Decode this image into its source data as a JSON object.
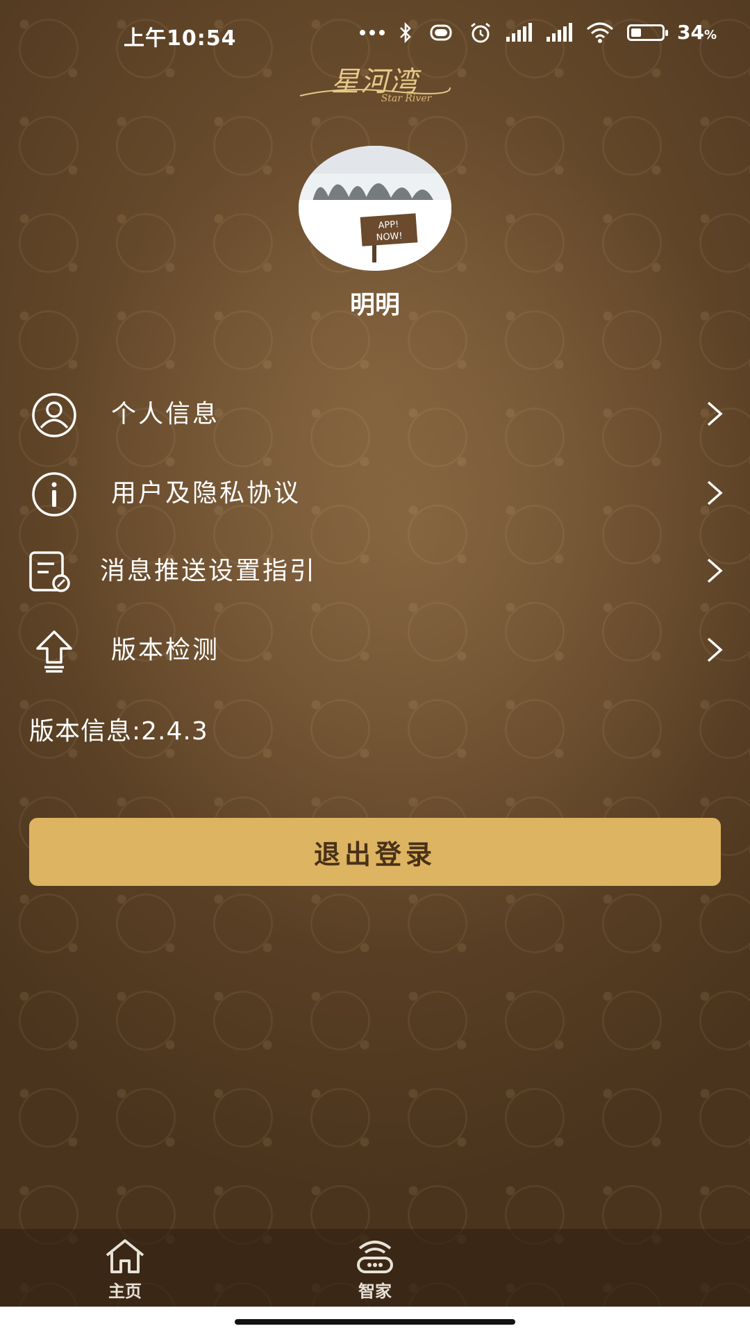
{
  "status_bar": {
    "time": "上午10:54",
    "battery_text": "34",
    "battery_unit": "%",
    "battery_level": 0.34,
    "icons": [
      "more-dots-icon",
      "bluetooth-icon",
      "vibrate-icon",
      "alarm-icon",
      "signal-icon",
      "signal-icon",
      "wifi-icon",
      "battery-icon"
    ]
  },
  "logo": {
    "text": "星河湾",
    "sub": "Star River"
  },
  "profile": {
    "username": "明明"
  },
  "menu": [
    {
      "label": "个人信息",
      "icon": "user-icon"
    },
    {
      "label": "用户及隐私协议",
      "icon": "info-icon"
    },
    {
      "label": "消息推送设置指引",
      "icon": "document-settings-icon"
    },
    {
      "label": "版本检测",
      "icon": "upload-arrow-icon"
    }
  ],
  "version_info": "版本信息:2.4.3",
  "logout_button": "退出登录",
  "bottom_nav": [
    {
      "label": "主页",
      "icon": "home-icon"
    },
    {
      "label": "智家",
      "icon": "router-icon"
    }
  ],
  "colors": {
    "accent": "#ddb462",
    "background": "#5f4427",
    "button_text": "#4a3218"
  }
}
